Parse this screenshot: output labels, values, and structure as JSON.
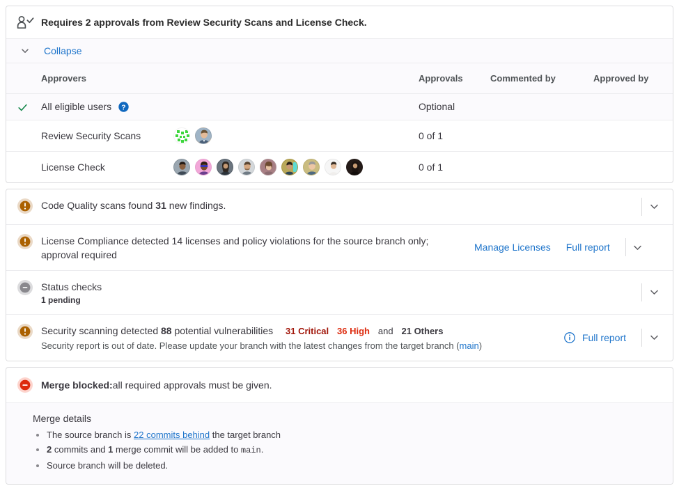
{
  "approvals": {
    "header_text": "Requires 2 approvals from Review Security Scans and License Check.",
    "header_icon": "person-check-icon",
    "collapse_label": "Collapse",
    "collapse_icon": "chevron-down-icon",
    "columns": [
      "Approvers",
      "Approvals",
      "Commented by",
      "Approved by"
    ],
    "rows": [
      {
        "mark": "check-green-icon",
        "name": "All eligible users",
        "help_icon": "question-circle-icon",
        "approvals": "Optional",
        "commented_by": "",
        "approved_by": "",
        "avatars": []
      },
      {
        "mark": "",
        "name": "Review Security Scans",
        "help_icon": "",
        "approvals": "0 of 1",
        "commented_by": "",
        "approved_by": "",
        "avatars": [
          "identicon-green",
          "photo-man-outdoors"
        ]
      },
      {
        "mark": "",
        "name": "License Check",
        "help_icon": "",
        "approvals": "0 of 1",
        "commented_by": "",
        "approved_by": "",
        "avatars": [
          "photo-person-1",
          "photo-person-2",
          "photo-person-3",
          "photo-person-4",
          "photo-person-5",
          "photo-person-6",
          "photo-person-7",
          "photo-person-8",
          "photo-person-9"
        ]
      }
    ]
  },
  "widgets": {
    "code_quality": {
      "icon": "warning-icon",
      "text_before": "Code Quality scans found",
      "count": "31",
      "text_after": "new findings.",
      "chevron_icon": "chevron-down-icon"
    },
    "license_compliance": {
      "icon": "warning-icon",
      "text": "License Compliance detected 14 licenses and policy violations for the source branch only; approval required",
      "manage_label": "Manage Licenses",
      "report_label": "Full report",
      "chevron_icon": "chevron-down-icon"
    },
    "status_checks": {
      "icon": "pending-icon",
      "title": "Status checks",
      "subtitle": "1 pending",
      "chevron_icon": "chevron-down-icon"
    },
    "security": {
      "icon": "warning-icon",
      "text_before": "Security scanning detected",
      "count": "88",
      "text_after": "potential vulnerabilities",
      "critical": "31 Critical",
      "high": "36 High",
      "and": "and",
      "others": "21 Others",
      "note_before": "Security report is out of date. Please update your branch with the latest changes from the target branch (",
      "note_branch": "main",
      "note_after": ")",
      "info_icon": "info-circle-icon",
      "report_label": "Full report",
      "chevron_icon": "chevron-down-icon"
    }
  },
  "merge_blocked": {
    "icon": "blocked-icon",
    "title": "Merge blocked:",
    "subtitle": " all required approvals must be given.",
    "details_title": "Merge details",
    "items": [
      {
        "before": "The source branch is ",
        "link": "22 commits behind",
        "after": " the target branch"
      },
      {
        "bold1": "2",
        "mid1": " commits and ",
        "bold2": "1",
        "mid2": " merge commit will be added to ",
        "code": "main",
        "tail": "."
      },
      {
        "plain": "Source branch will be deleted."
      }
    ]
  },
  "colors": {
    "link": "#1f75cb",
    "warning": "#ab6100",
    "warning_ring": "#e9dbcb",
    "critical": "#a1160a",
    "high": "#dd2b0e",
    "blocked": "#dd2b0e",
    "success": "#108548",
    "border": "#dcdcde",
    "row_alt": "#fbfafd"
  }
}
